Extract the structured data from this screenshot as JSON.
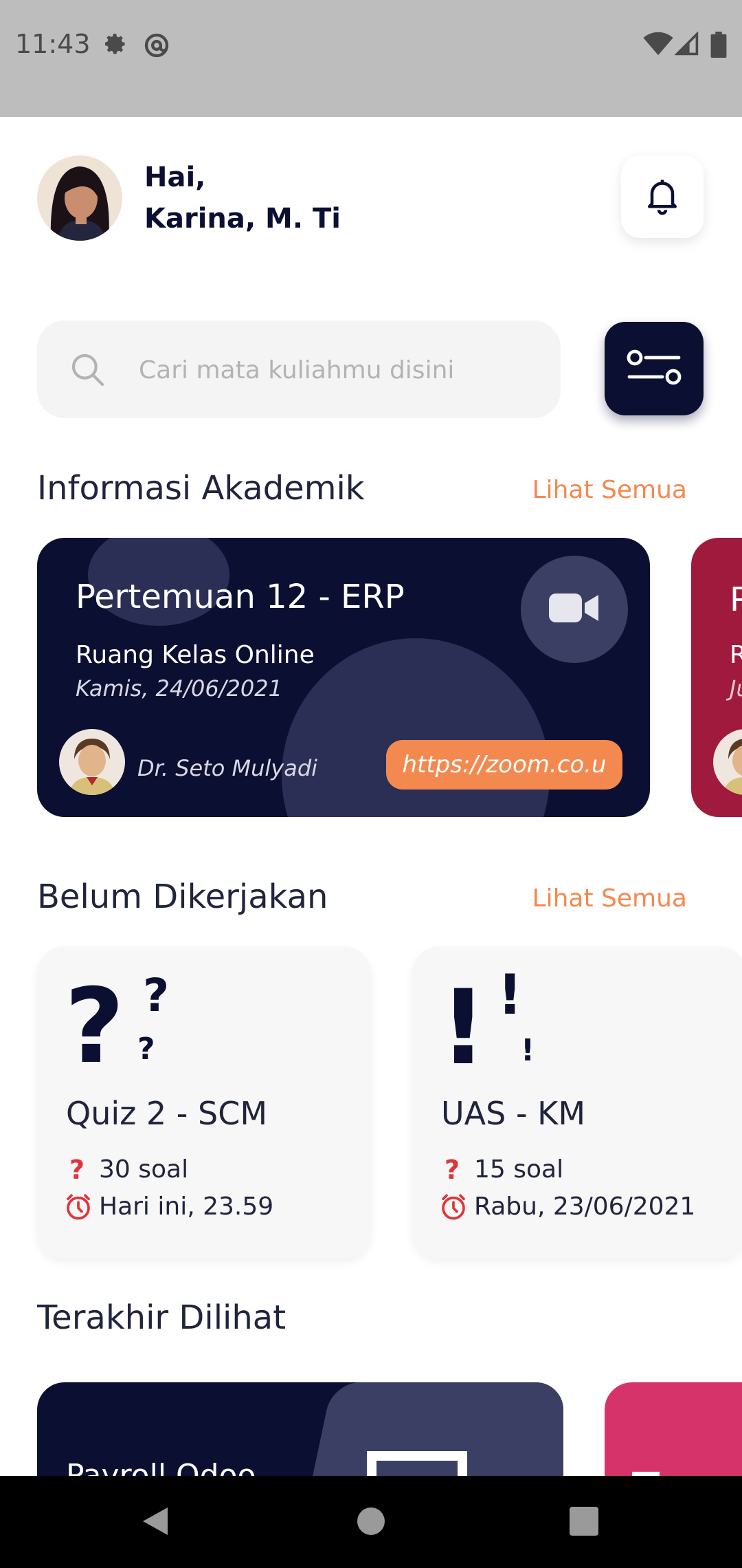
{
  "status_bar": {
    "time": "11:43"
  },
  "header": {
    "greeting_line1": "Hai,",
    "greeting_line2": "Karina, M. Ti"
  },
  "search": {
    "placeholder": "Cari mata kuliahmu disini",
    "value": ""
  },
  "sections": {
    "academic_title": "Informasi Akademik",
    "academic_see_all": "Lihat Semua",
    "pending_title": "Belum Dikerjakan",
    "pending_see_all": "Lihat Semua",
    "recent_title": "Terakhir Dilihat"
  },
  "academic_cards": [
    {
      "title": "Pertemuan 12 - ERP",
      "room": "Ruang Kelas Online",
      "date": "Kamis, 24/06/2021",
      "lecturer": "Dr. Seto Mulyadi",
      "link": "https://zoom.co.u",
      "color": "#0b1033"
    },
    {
      "title_visible": "P",
      "room_visible": "R",
      "date_visible": "Ju",
      "color": "#a01a3e"
    }
  ],
  "task_cards": [
    {
      "title": "Quiz 2 - SCM",
      "count": "30 soal",
      "deadline": "Hari ini, 23.59",
      "glyph": "question-marks"
    },
    {
      "title": "UAS - KM",
      "count": "15 soal",
      "deadline": "Rabu, 23/06/2021",
      "glyph": "exclamation-marks"
    }
  ],
  "recent_cards": [
    {
      "title": "Payroll Odoo",
      "color": "#0b1033"
    },
    {
      "color": "#d6336a"
    }
  ],
  "colors": {
    "navy": "#0b1033",
    "accent_orange": "#f4894f",
    "crimson": "#a01a3e",
    "pink": "#d6336a",
    "alert_red": "#e2323a"
  }
}
